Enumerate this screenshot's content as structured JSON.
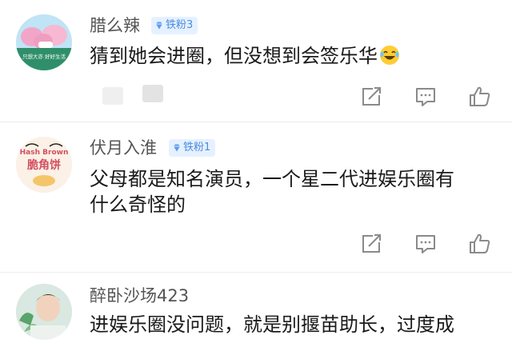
{
  "comments": [
    {
      "username": "腊么辣",
      "badge": "铁粉3",
      "lines": [
        "猜到她会进圈，但没想到会签乐华"
      ],
      "emoji": "laughing-tears-emoji",
      "avatar_caption": "只想大亦  好好生活"
    },
    {
      "username": "伏月入淮",
      "badge": "铁粉1",
      "lines": [
        "父母都是知名演员，一个星二代进娱乐圈有",
        "什么奇怪的"
      ],
      "avatar_caption": "Hash Brown",
      "avatar_caption_2": "脆角饼"
    },
    {
      "username": "醉卧沙场423",
      "lines": [
        "进娱乐圈没问题，就是别揠苗助长，过度成"
      ]
    }
  ],
  "icons": {
    "share": "share-icon",
    "comment": "comment-icon",
    "like": "like-icon",
    "badge": "diamond-icon"
  },
  "colors": {
    "badge_bg": "#e6f1ff",
    "badge_text": "#4a8be0",
    "username": "#555555",
    "text": "#1a1a1a",
    "icon": "#8a8a8a"
  }
}
